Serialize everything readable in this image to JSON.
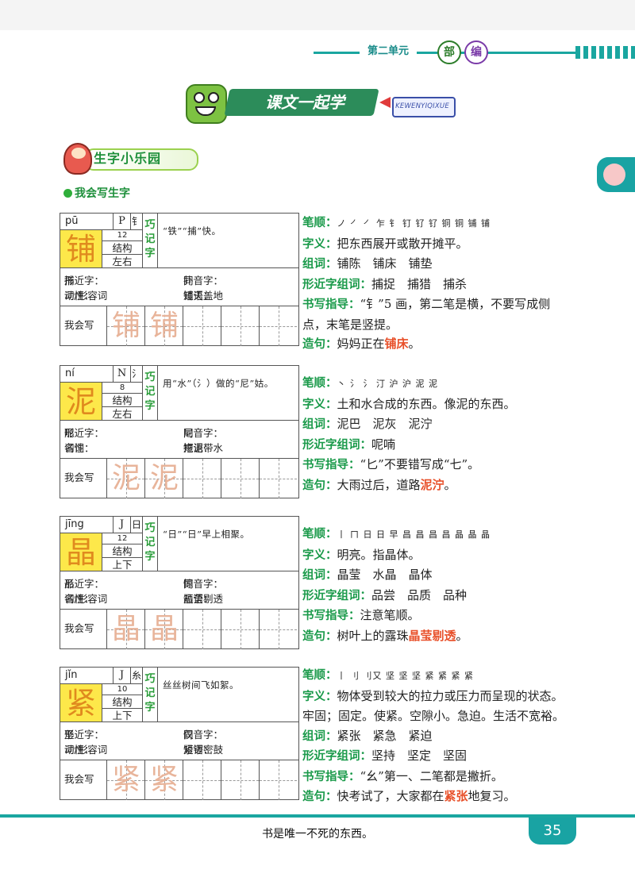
{
  "header": {
    "unit_title": "第二单元",
    "badge1": "部",
    "badge2": "编"
  },
  "banner": {
    "title": "课文一起学",
    "romanized": "KEWENYIQIXUE"
  },
  "section": {
    "title": "生字小乐园",
    "subtitle": "我会写生字"
  },
  "labels": {
    "qiaoji": "巧记字",
    "structure": "结构",
    "similar": "形近字：",
    "homophone": "同音字：",
    "pos": "词性：",
    "phrase": "短语：",
    "write": "我会写",
    "bishun": "笔顺：",
    "ziyi": "字义：",
    "zuci": "组词：",
    "xingjin_zuci": "形近字组词：",
    "shuxie": "书写指导：",
    "zaoju": "造句："
  },
  "characters": [
    {
      "pinyin": "pū",
      "index": "P",
      "radical": "钅",
      "char": "铺",
      "strokes": "12",
      "structure": "左右",
      "memo": "“铁”“捕”快。",
      "similar": "捕",
      "homophone": "扑",
      "pos": "动/形容词",
      "phrase": "铺天盖地",
      "trace": [
        "铺",
        "铺"
      ],
      "stroke_order": "ノ ㇒ ㇒ 乍 钅 钉 钌 钌 铜 铜 铺 铺",
      "meaning": "把东西展开或散开摊平。",
      "words": "铺陈　铺床　铺垫",
      "similar_words": "捕捉　捕猎　捕杀",
      "guide": "“钅”5 画，第二笔是横，不要写成侧点，末笔是竖提。",
      "sentence_pre": "妈妈正在",
      "sentence_hl": "铺床",
      "sentence_post": "。"
    },
    {
      "pinyin": "ní",
      "index": "N",
      "radical": "氵",
      "char": "泥",
      "strokes": "8",
      "structure": "左右",
      "memo": "用“水”（氵）做的“尼”姑。",
      "similar": "呢",
      "homophone": "尼",
      "pos": "名词",
      "phrase": "拖泥带水",
      "trace": [
        "泥",
        "泥"
      ],
      "stroke_order": "丶 氵 氵 汀 沪 沪 泥 泥",
      "meaning": "土和水合成的东西。像泥的东西。",
      "words": "泥巴　泥灰　泥泞",
      "similar_words": "呢喃",
      "guide": "“匕”不要错写成“七”。",
      "sentence_pre": "大雨过后，道路",
      "sentence_hl": "泥泞",
      "sentence_post": "。"
    },
    {
      "pinyin": "jīng",
      "index": "J",
      "radical": "日",
      "char": "晶",
      "strokes": "12",
      "structure": "上下",
      "memo": "“日”“日”早上相聚。",
      "similar": "品",
      "homophone": "惊",
      "pos": "名/形容词",
      "phrase": "晶莹剔透",
      "trace": [
        "晶",
        "晶"
      ],
      "stroke_order": "丨 ㄇ 日 日 早 昌 昌 昌 昌 晶 晶 晶",
      "meaning": "明亮。指晶体。",
      "words": "晶莹　水晶　晶体",
      "similar_words": "品尝　品质　品种",
      "guide": "注意笔顺。",
      "sentence_pre": "树叶上的露珠",
      "sentence_hl": "晶莹剔透",
      "sentence_post": "。"
    },
    {
      "pinyin": "jǐn",
      "index": "J",
      "radical": "糸",
      "char": "紧",
      "strokes": "10",
      "structure": "上下",
      "memo": "丝丝树间飞如絮。",
      "similar": "坚",
      "homophone": "仅",
      "pos": "动/形容词",
      "phrase": "紧锣密鼓",
      "trace": [
        "紧",
        "紧"
      ],
      "stroke_order": "丨 刂 刂又 坚 坚 坚 紧 紧 紧 紧",
      "meaning": "物体受到较大的拉力或压力而呈现的状态。牢固；固定。使紧。空隙小。急迫。生活不宽裕。",
      "words": "紧张　紧急　紧迫",
      "similar_words": "坚持　坚定　坚固",
      "guide": "“幺”第一、二笔都是撇折。",
      "sentence_pre": "快考试了，大家都在",
      "sentence_hl": "紧张",
      "sentence_post": "地复习。"
    }
  ],
  "footer": {
    "quote": "书是唯一不死的东西。",
    "page": "35"
  }
}
